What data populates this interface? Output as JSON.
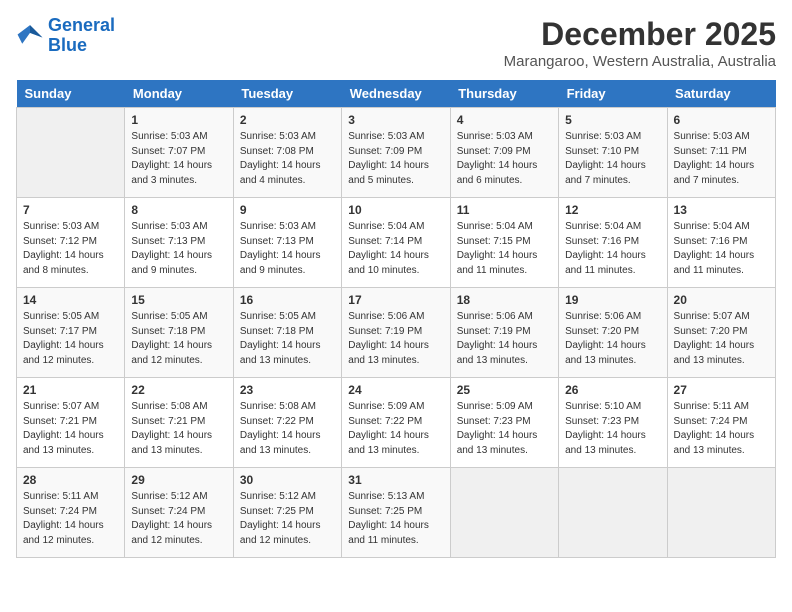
{
  "header": {
    "logo_line1": "General",
    "logo_line2": "Blue",
    "month": "December 2025",
    "location": "Marangaroo, Western Australia, Australia"
  },
  "weekdays": [
    "Sunday",
    "Monday",
    "Tuesday",
    "Wednesday",
    "Thursday",
    "Friday",
    "Saturday"
  ],
  "weeks": [
    [
      {
        "day": "",
        "sunrise": "",
        "sunset": "",
        "daylight": ""
      },
      {
        "day": "1",
        "sunrise": "Sunrise: 5:03 AM",
        "sunset": "Sunset: 7:07 PM",
        "daylight": "Daylight: 14 hours and 3 minutes."
      },
      {
        "day": "2",
        "sunrise": "Sunrise: 5:03 AM",
        "sunset": "Sunset: 7:08 PM",
        "daylight": "Daylight: 14 hours and 4 minutes."
      },
      {
        "day": "3",
        "sunrise": "Sunrise: 5:03 AM",
        "sunset": "Sunset: 7:09 PM",
        "daylight": "Daylight: 14 hours and 5 minutes."
      },
      {
        "day": "4",
        "sunrise": "Sunrise: 5:03 AM",
        "sunset": "Sunset: 7:09 PM",
        "daylight": "Daylight: 14 hours and 6 minutes."
      },
      {
        "day": "5",
        "sunrise": "Sunrise: 5:03 AM",
        "sunset": "Sunset: 7:10 PM",
        "daylight": "Daylight: 14 hours and 7 minutes."
      },
      {
        "day": "6",
        "sunrise": "Sunrise: 5:03 AM",
        "sunset": "Sunset: 7:11 PM",
        "daylight": "Daylight: 14 hours and 7 minutes."
      }
    ],
    [
      {
        "day": "7",
        "sunrise": "Sunrise: 5:03 AM",
        "sunset": "Sunset: 7:12 PM",
        "daylight": "Daylight: 14 hours and 8 minutes."
      },
      {
        "day": "8",
        "sunrise": "Sunrise: 5:03 AM",
        "sunset": "Sunset: 7:13 PM",
        "daylight": "Daylight: 14 hours and 9 minutes."
      },
      {
        "day": "9",
        "sunrise": "Sunrise: 5:03 AM",
        "sunset": "Sunset: 7:13 PM",
        "daylight": "Daylight: 14 hours and 9 minutes."
      },
      {
        "day": "10",
        "sunrise": "Sunrise: 5:04 AM",
        "sunset": "Sunset: 7:14 PM",
        "daylight": "Daylight: 14 hours and 10 minutes."
      },
      {
        "day": "11",
        "sunrise": "Sunrise: 5:04 AM",
        "sunset": "Sunset: 7:15 PM",
        "daylight": "Daylight: 14 hours and 11 minutes."
      },
      {
        "day": "12",
        "sunrise": "Sunrise: 5:04 AM",
        "sunset": "Sunset: 7:16 PM",
        "daylight": "Daylight: 14 hours and 11 minutes."
      },
      {
        "day": "13",
        "sunrise": "Sunrise: 5:04 AM",
        "sunset": "Sunset: 7:16 PM",
        "daylight": "Daylight: 14 hours and 11 minutes."
      }
    ],
    [
      {
        "day": "14",
        "sunrise": "Sunrise: 5:05 AM",
        "sunset": "Sunset: 7:17 PM",
        "daylight": "Daylight: 14 hours and 12 minutes."
      },
      {
        "day": "15",
        "sunrise": "Sunrise: 5:05 AM",
        "sunset": "Sunset: 7:18 PM",
        "daylight": "Daylight: 14 hours and 12 minutes."
      },
      {
        "day": "16",
        "sunrise": "Sunrise: 5:05 AM",
        "sunset": "Sunset: 7:18 PM",
        "daylight": "Daylight: 14 hours and 13 minutes."
      },
      {
        "day": "17",
        "sunrise": "Sunrise: 5:06 AM",
        "sunset": "Sunset: 7:19 PM",
        "daylight": "Daylight: 14 hours and 13 minutes."
      },
      {
        "day": "18",
        "sunrise": "Sunrise: 5:06 AM",
        "sunset": "Sunset: 7:19 PM",
        "daylight": "Daylight: 14 hours and 13 minutes."
      },
      {
        "day": "19",
        "sunrise": "Sunrise: 5:06 AM",
        "sunset": "Sunset: 7:20 PM",
        "daylight": "Daylight: 14 hours and 13 minutes."
      },
      {
        "day": "20",
        "sunrise": "Sunrise: 5:07 AM",
        "sunset": "Sunset: 7:20 PM",
        "daylight": "Daylight: 14 hours and 13 minutes."
      }
    ],
    [
      {
        "day": "21",
        "sunrise": "Sunrise: 5:07 AM",
        "sunset": "Sunset: 7:21 PM",
        "daylight": "Daylight: 14 hours and 13 minutes."
      },
      {
        "day": "22",
        "sunrise": "Sunrise: 5:08 AM",
        "sunset": "Sunset: 7:21 PM",
        "daylight": "Daylight: 14 hours and 13 minutes."
      },
      {
        "day": "23",
        "sunrise": "Sunrise: 5:08 AM",
        "sunset": "Sunset: 7:22 PM",
        "daylight": "Daylight: 14 hours and 13 minutes."
      },
      {
        "day": "24",
        "sunrise": "Sunrise: 5:09 AM",
        "sunset": "Sunset: 7:22 PM",
        "daylight": "Daylight: 14 hours and 13 minutes."
      },
      {
        "day": "25",
        "sunrise": "Sunrise: 5:09 AM",
        "sunset": "Sunset: 7:23 PM",
        "daylight": "Daylight: 14 hours and 13 minutes."
      },
      {
        "day": "26",
        "sunrise": "Sunrise: 5:10 AM",
        "sunset": "Sunset: 7:23 PM",
        "daylight": "Daylight: 14 hours and 13 minutes."
      },
      {
        "day": "27",
        "sunrise": "Sunrise: 5:11 AM",
        "sunset": "Sunset: 7:24 PM",
        "daylight": "Daylight: 14 hours and 13 minutes."
      }
    ],
    [
      {
        "day": "28",
        "sunrise": "Sunrise: 5:11 AM",
        "sunset": "Sunset: 7:24 PM",
        "daylight": "Daylight: 14 hours and 12 minutes."
      },
      {
        "day": "29",
        "sunrise": "Sunrise: 5:12 AM",
        "sunset": "Sunset: 7:24 PM",
        "daylight": "Daylight: 14 hours and 12 minutes."
      },
      {
        "day": "30",
        "sunrise": "Sunrise: 5:12 AM",
        "sunset": "Sunset: 7:25 PM",
        "daylight": "Daylight: 14 hours and 12 minutes."
      },
      {
        "day": "31",
        "sunrise": "Sunrise: 5:13 AM",
        "sunset": "Sunset: 7:25 PM",
        "daylight": "Daylight: 14 hours and 11 minutes."
      },
      {
        "day": "",
        "sunrise": "",
        "sunset": "",
        "daylight": ""
      },
      {
        "day": "",
        "sunrise": "",
        "sunset": "",
        "daylight": ""
      },
      {
        "day": "",
        "sunrise": "",
        "sunset": "",
        "daylight": ""
      }
    ]
  ]
}
